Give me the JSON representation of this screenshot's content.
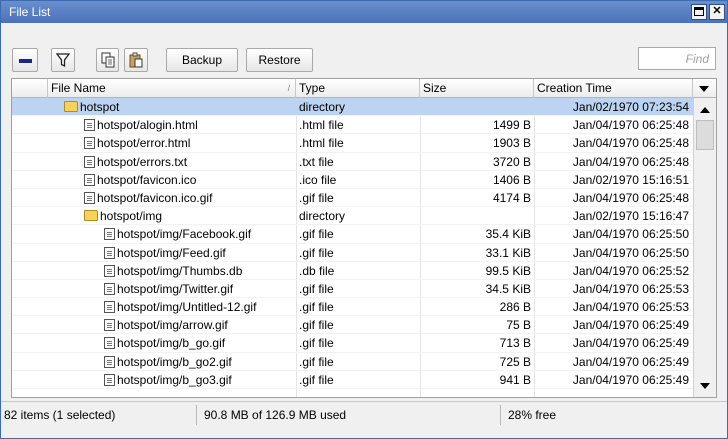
{
  "window": {
    "title": "File List"
  },
  "toolbar": {
    "backup_label": "Backup",
    "restore_label": "Restore",
    "find_placeholder": "Find",
    "icons": [
      "minus-icon",
      "filter-icon",
      "copy-icon",
      "paste-icon"
    ]
  },
  "table": {
    "headers": {
      "name": "File Name",
      "type": "Type",
      "size": "Size",
      "ctime": "Creation Time"
    },
    "rows": [
      {
        "name": "hotspot",
        "type": "directory",
        "size": "",
        "ctime": "Jan/02/1970 07:23:54",
        "kind": "dir",
        "level": 0,
        "selected": true
      },
      {
        "name": "hotspot/alogin.html",
        "type": ".html file",
        "size": "1499 B",
        "ctime": "Jan/04/1970 06:25:48",
        "kind": "file",
        "level": 1
      },
      {
        "name": "hotspot/error.html",
        "type": ".html file",
        "size": "1903 B",
        "ctime": "Jan/04/1970 06:25:48",
        "kind": "file",
        "level": 1
      },
      {
        "name": "hotspot/errors.txt",
        "type": ".txt file",
        "size": "3720 B",
        "ctime": "Jan/04/1970 06:25:48",
        "kind": "file",
        "level": 1
      },
      {
        "name": "hotspot/favicon.ico",
        "type": ".ico file",
        "size": "1406 B",
        "ctime": "Jan/02/1970 15:16:51",
        "kind": "file",
        "level": 1
      },
      {
        "name": "hotspot/favicon.ico.gif",
        "type": ".gif file",
        "size": "4174 B",
        "ctime": "Jan/04/1970 06:25:48",
        "kind": "file",
        "level": 1
      },
      {
        "name": "hotspot/img",
        "type": "directory",
        "size": "",
        "ctime": "Jan/02/1970 15:16:47",
        "kind": "dir",
        "level": 1
      },
      {
        "name": "hotspot/img/Facebook.gif",
        "type": ".gif file",
        "size": "35.4 KiB",
        "ctime": "Jan/04/1970 06:25:50",
        "kind": "file",
        "level": 2
      },
      {
        "name": "hotspot/img/Feed.gif",
        "type": ".gif file",
        "size": "33.1 KiB",
        "ctime": "Jan/04/1970 06:25:50",
        "kind": "file",
        "level": 2
      },
      {
        "name": "hotspot/img/Thumbs.db",
        "type": ".db file",
        "size": "99.5 KiB",
        "ctime": "Jan/04/1970 06:25:52",
        "kind": "file",
        "level": 2
      },
      {
        "name": "hotspot/img/Twitter.gif",
        "type": ".gif file",
        "size": "34.5 KiB",
        "ctime": "Jan/04/1970 06:25:53",
        "kind": "file",
        "level": 2
      },
      {
        "name": "hotspot/img/Untitled-12.gif",
        "type": ".gif file",
        "size": "286 B",
        "ctime": "Jan/04/1970 06:25:53",
        "kind": "file",
        "level": 2
      },
      {
        "name": "hotspot/img/arrow.gif",
        "type": ".gif file",
        "size": "75 B",
        "ctime": "Jan/04/1970 06:25:49",
        "kind": "file",
        "level": 2
      },
      {
        "name": "hotspot/img/b_go.gif",
        "type": ".gif file",
        "size": "713 B",
        "ctime": "Jan/04/1970 06:25:49",
        "kind": "file",
        "level": 2
      },
      {
        "name": "hotspot/img/b_go2.gif",
        "type": ".gif file",
        "size": "725 B",
        "ctime": "Jan/04/1970 06:25:49",
        "kind": "file",
        "level": 2
      },
      {
        "name": "hotspot/img/b_go3.gif",
        "type": ".gif file",
        "size": "941 B",
        "ctime": "Jan/04/1970 06:25:49",
        "kind": "file",
        "level": 2
      }
    ]
  },
  "status": {
    "items": "82 items (1 selected)",
    "used": "90.8 MB of 126.9 MB used",
    "free": "28% free"
  },
  "colors": {
    "titlebar": "#4a72b9",
    "selection": "#bcd4f2",
    "folder": "#f5d35b"
  }
}
